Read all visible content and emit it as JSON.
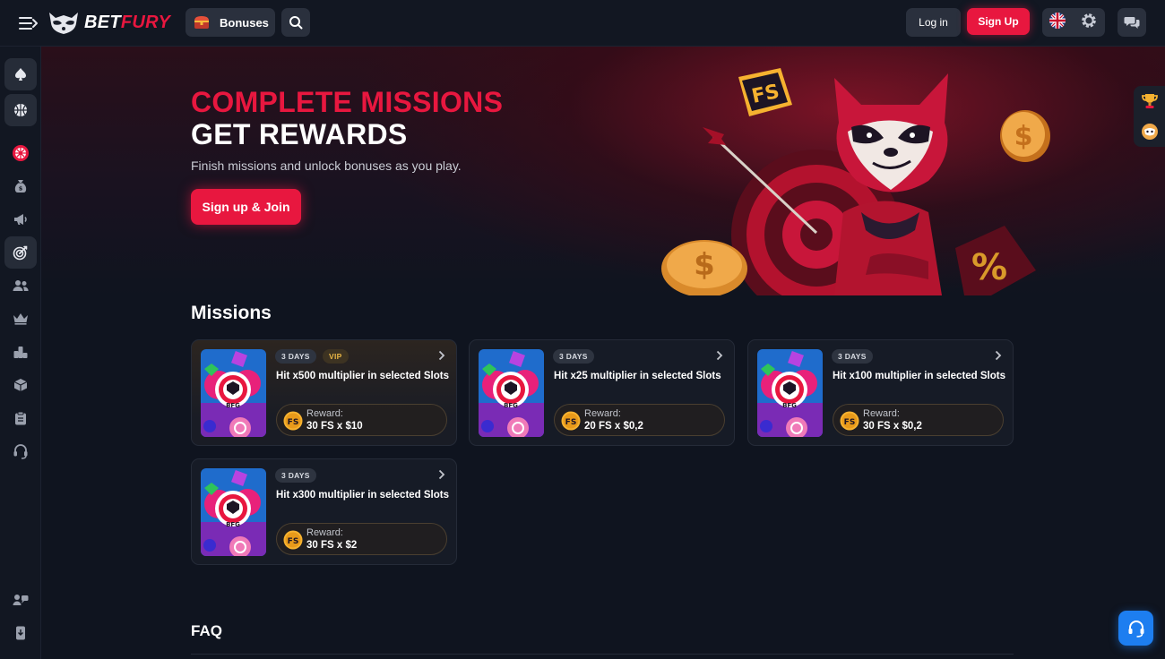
{
  "header": {
    "logo_text_white": "BET",
    "logo_text_red": "FURY",
    "bonuses_label": "Bonuses",
    "login_label": "Log in",
    "signup_label": "Sign Up"
  },
  "sidebar": {
    "items": [
      {
        "icon": "spade-icon"
      },
      {
        "icon": "basketball-icon"
      },
      {
        "icon": "wheel-icon"
      },
      {
        "icon": "money-bag-icon"
      },
      {
        "icon": "megaphone-icon"
      },
      {
        "icon": "target-icon"
      },
      {
        "icon": "users-icon"
      },
      {
        "icon": "crown-icon"
      },
      {
        "icon": "leaderboard-icon"
      },
      {
        "icon": "box-icon"
      },
      {
        "icon": "clipboard-icon"
      },
      {
        "icon": "headset-icon"
      },
      {
        "icon": "community-icon"
      },
      {
        "icon": "mobile-app-icon"
      }
    ]
  },
  "hero": {
    "title_line1": "COMPLETE MISSIONS",
    "title_line2": "GET REWARDS",
    "subtitle": "Finish missions and unlock bonuses as you play.",
    "cta_label": "Sign up & Join"
  },
  "missions": {
    "title": "Missions",
    "reward_label": "Reward:",
    "cards": [
      {
        "duration": "3 DAYS",
        "vip": "VIP",
        "title": "Hit x500 multiplier in selected Slots",
        "reward": "30 FS x $10"
      },
      {
        "duration": "3 DAYS",
        "title": "Hit x25 multiplier in selected Slots",
        "reward": "20 FS x $0,2"
      },
      {
        "duration": "3 DAYS",
        "title": "Hit x100 multiplier in selected Slots",
        "reward": "30 FS x $0,2"
      },
      {
        "duration": "3 DAYS",
        "title": "Hit x300 multiplier in selected Slots",
        "reward": "30 FS x $2"
      }
    ]
  },
  "faq": {
    "title": "FAQ"
  },
  "colors": {
    "brand_red": "#e8173f",
    "background": "#0f141f",
    "panel": "#2a303d",
    "support_blue": "#1d7ef0"
  }
}
